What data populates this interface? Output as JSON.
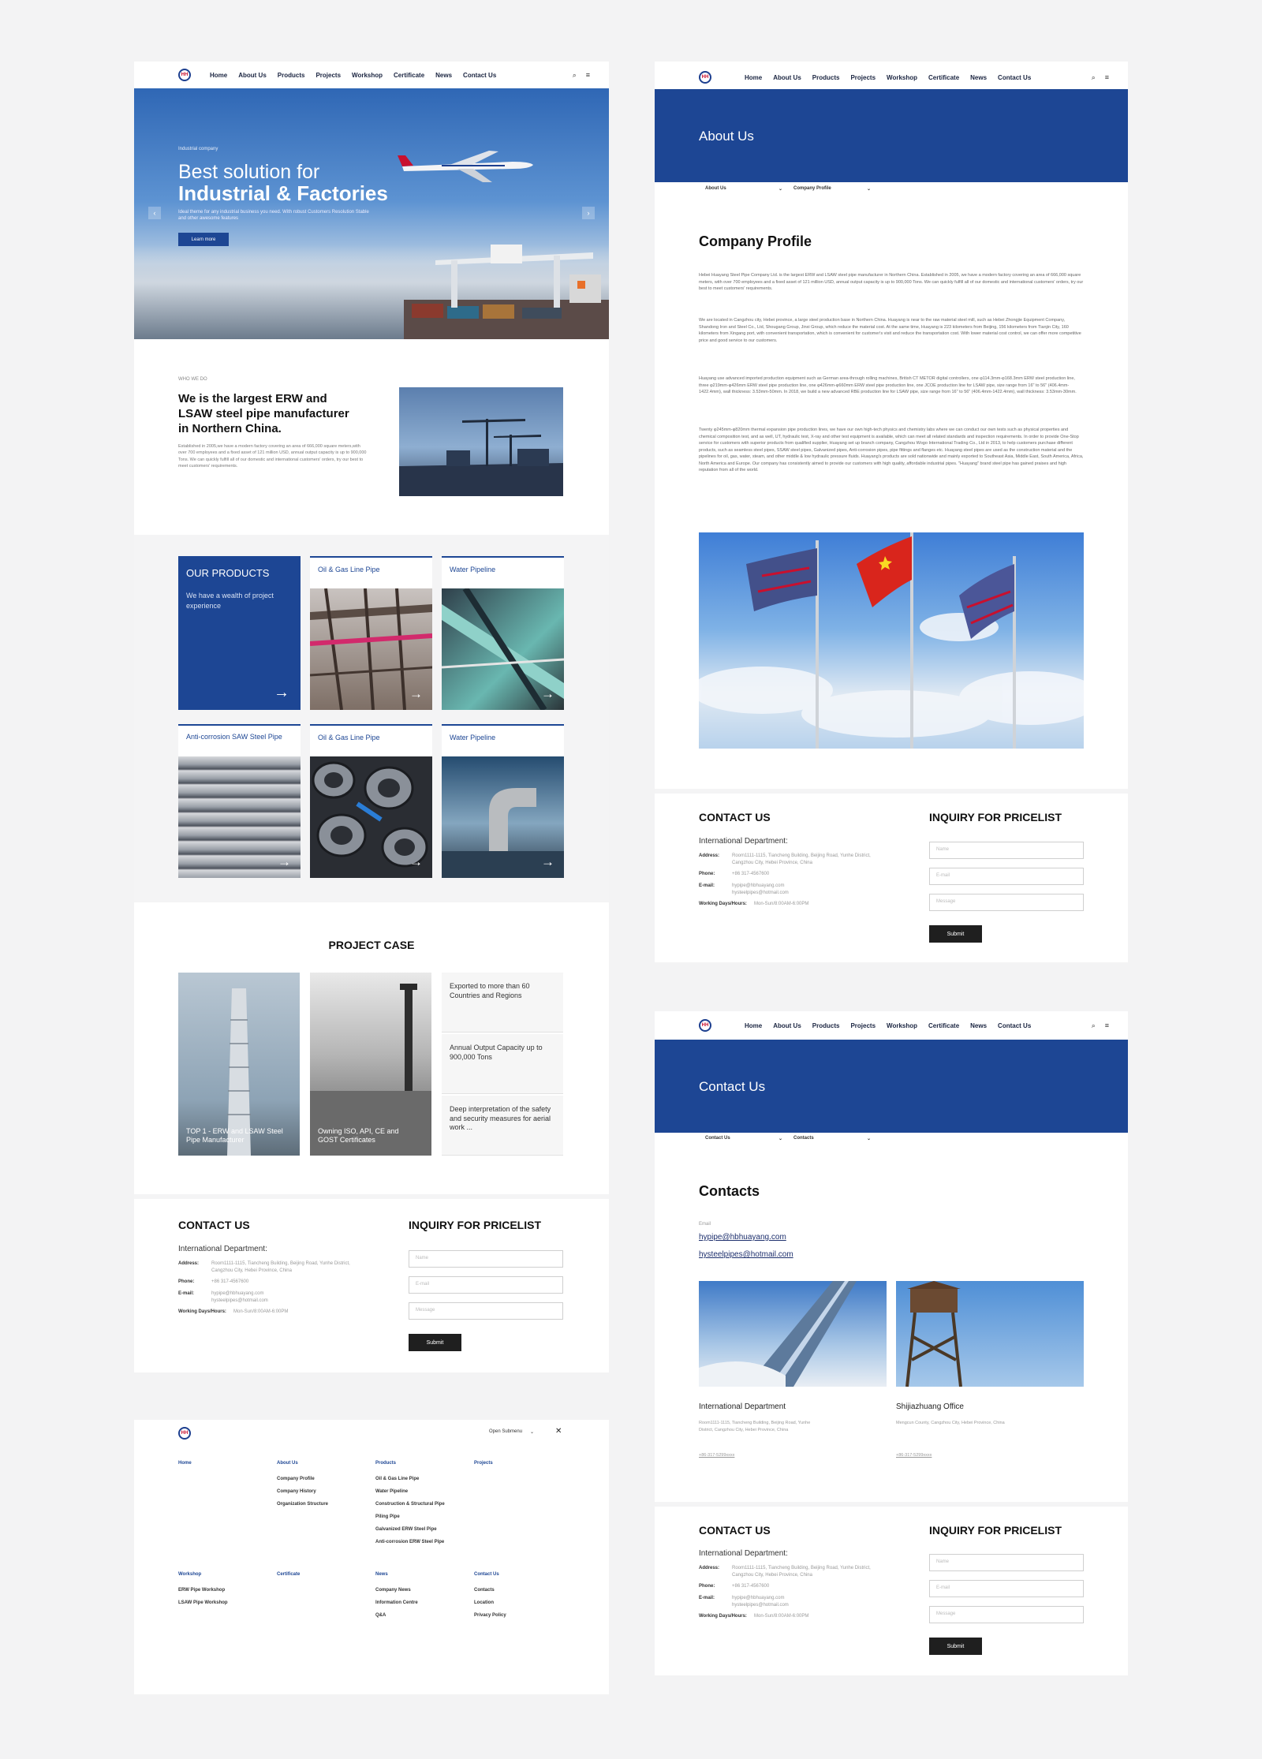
{
  "nav": {
    "logo": "HH",
    "items": [
      "Home",
      "About Us",
      "Products",
      "Projects",
      "Workshop",
      "Certificate",
      "News",
      "Contact Us"
    ],
    "search_icon": "search-icon",
    "menu_icon": "hamburger-icon"
  },
  "home": {
    "hero": {
      "small": "Industrial company",
      "title_1": "Best solution for",
      "title_2": "Industrial & Factories",
      "text": "Ideal theme for any industrial business you need. With robust Customers Resolution Stable and other awesome features",
      "button": "Learn more",
      "prev": "‹",
      "next": "›"
    },
    "about": {
      "label": "WHO WE DO",
      "heading": "We is the largest ERW and LSAW steel pipe manufacturer in Northern China.",
      "text": "Established in 2005,we have a modern factory covering an area of 666,000 square meters,with over 700 employees and a fixed asset of 121 million USD, annual output capacity is up to 900,000 Tons. We can quickly fulfill all of our domestic and international customers' orders, try our best to meet customers' requirements."
    },
    "products": {
      "title": "OUR PRODUCTS",
      "subtitle": "We have a wealth of project experience",
      "arrow": "→",
      "tiles": [
        "Oil & Gas Line Pipe",
        "Water Pipeline",
        "Anti-corrosion SAW Steel Pipe",
        "Oil & Gas Line Pipe",
        "Water Pipeline"
      ]
    },
    "projects": {
      "title": "PROJECT CASE",
      "case_1": "TOP 1 - ERW and LSAW Steel Pipe Manufacturer",
      "case_2": "Owning ISO, API, CE and GOST Certificates",
      "stats": [
        "Exported to more than 60 Countries and Regions",
        "Annual Output Capacity up to 900,000 Tons",
        "Deep interpretation of the safety and security measures for aerial work ..."
      ]
    }
  },
  "contact_block": {
    "title": "CONTACT US",
    "dept": "International Department:",
    "address_label": "Address:",
    "address": "Room1111-1115, Tiancheng Building, Beijing Road, Yunhe District, Cangzhou City, Hebei Province, China",
    "phone_label": "Phone:",
    "phone": "+86 317-4567600",
    "email_label": "E-mail:",
    "email_1": "hypipe@hbhuayang.com",
    "email_2": "hysteelpipes@hotmail.com",
    "hours_label": "Working Days/Hours:",
    "hours": "Mon-Sun/8:00AM-6:00PM",
    "inquiry_title": "INQUIRY FOR PRICELIST",
    "name_ph": "Name",
    "email_ph": "E-mail",
    "message_ph": "Message",
    "submit": "Submit"
  },
  "footer_menu": {
    "open_label": "Open Submenu",
    "chevron": "⌄",
    "close": "✕",
    "home": "Home",
    "about": "About Us",
    "about_items": [
      "Company Profile",
      "Company History",
      "Organization Structure"
    ],
    "products": "Products",
    "product_items": [
      "Oil & Gas Line Pipe",
      "Water Pipeline",
      "Construction & Structural Pipe",
      "Piling Pipe",
      "Galvanized ERW Steel Pipe",
      "Anti-corrosion ERW Steel Pipe"
    ],
    "projects": "Projects",
    "workshop": "Workshop",
    "workshop_items": [
      "ERW Pipe Workshop",
      "LSAW Pipe Workshop"
    ],
    "certificate": "Certificate",
    "news": "News",
    "news_items": [
      "Company News",
      "Information Centre",
      "Q&A"
    ],
    "contact": "Contact Us",
    "contact_items": [
      "Contacts",
      "Location",
      "Privacy Policy"
    ]
  },
  "about_page": {
    "banner": "About Us",
    "crumb_1": "About Us",
    "crumb_2": "Company Profile",
    "chevron": "⌄",
    "title": "Company Profile",
    "p1": "Hebei Huayang Steel Pipe Company Ltd. is the largest ERW and LSAW steel pipe manufacturer in Northern China. Established in 2005, we have a modern factory covering an area of 666,000 square meters, with over 700 employees and a fixed asset of 121 million USD, annual output capacity is up to 900,000 Tons. We can quickly fulfill all of our domestic and international customers' orders, try our best to meet customers' requirements.",
    "p2": "We are located in Cangzhou city, Hebei province, a large steel production base in Northern China. Huayang is near to the raw material steel mill, such as Hebei Zhongjie Equipment Company, Shandong Iron and Steel Co., Ltd, Shougang Group, Jinxi Group, which reduce the material cost. At the same time, Huayang is 223 kilometers from Beijing, 156 kilometers from Tianjin City, 160 kilometers from Xingang port, with convenient transportation, which is convenient for customer's visit and reduce the transportation cost. With lower material cost control, we can offer more competitive price and good service to our customers.",
    "p3": "Huayang use advanced imported production equipment such as German area-through rolling machines, British CT METOR digital controllers, one φ114.3mm-φ168.3mm ERW steel production line, three φ219mm-φ426mm ERW steel pipe production line, one φ426mm-φ660mm ERW steel pipe production line, one JCOE production line for LSAW pipe, size range from 16\" to 56\" (406.4mm-1422.4mm), wall thickness: 3.53mm-50mm. In 2018, we build a new advanced RBE production line for LSAW pipe, size range from 16\" to 56\" (406.4mm-1422.4mm), wall thickness: 3.53mm-30mm.",
    "p4": "Twenty φ245mm-φ820mm thermal expansion pipe production lines, we have our own high-tech physics and chemistry labs where we can conduct our own tests such as physical properties and chemical composition test, and as well, UT, hydraulic test, X-ray and other test equipment is available, which can meet all related standards and inspection requirements. In order to provide One-Stop service for customers with superior products from qualified supplier, Huayang set up branch company, Cangzhou Wogo International Trading Co., Ltd in 2013, to help customers purchase different products, such as seamless steel pipes, SSAW steel pipes, Galvanized pipes, Anti-corrosion pipes, pipe fittings and flanges etc. Huayang steel pipes are used as the construction material and the pipelines for oil, gas, water, steam, and other middle & low hydraulic pressure fluids. Huayang's products are sold nationwide and mainly exported to Southeast Asia, Middle East, South America, Africa, North America and Europe. Our company has consistently aimed to provide our customers with high quality, affordable industrial pipes. \"Huayang\" brand steel pipe has gained praises and high reputation from all of the world."
  },
  "contacts_page": {
    "banner": "Contact Us",
    "crumb_1": "Contact Us",
    "crumb_2": "Contacts",
    "chevron": "⌄",
    "title": "Contacts",
    "email_label": "Email",
    "email_1": "hypipe@hbhuayang.com",
    "email_2": "hysteelpipes@hotmail.com",
    "office_1": "International Department",
    "office_1_addr": "Room1111-1115, Tiancheng Building, Beijing Road, Yunhe District, Cangzhou City, Hebei Province, China",
    "office_1_phone": "+86-317-5299xxxx",
    "office_2": "Shijiazhuang Office",
    "office_2_addr": "Mengcun County, Cangzhou City, Hebei Province, China",
    "office_2_phone": "+86-317-5299xxxx"
  }
}
